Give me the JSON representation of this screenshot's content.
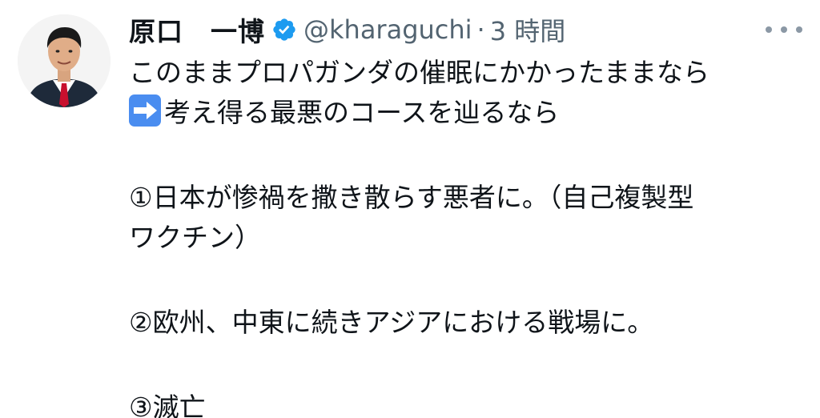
{
  "author": {
    "name": "原口　一博",
    "handle": "@kharaguchi",
    "separator": "·",
    "time": "3 時間",
    "verified": true,
    "avatar": "profile-photo-man-in-suit"
  },
  "icons": {
    "verified": "verified-badge-icon",
    "more": "more-options-icon",
    "arrow": "right-arrow-emoji-icon"
  },
  "colors": {
    "verified": "#1d9bf0",
    "muted_text": "#536471",
    "text": "#0f1419",
    "emoji_bg": "#4a8df0"
  },
  "tweet": {
    "line1": "このままプロパガンダの催眠にかかったままなら",
    "line2": "考え得る最悪のコースを辿るなら",
    "item1_line1": "①日本が惨禍を撒き散らす悪者に。（自己複製型",
    "item1_line2": "ワクチン）",
    "item2": "②欧州、中東に続きアジアにおける戦場に。",
    "item3": "③滅亡"
  }
}
